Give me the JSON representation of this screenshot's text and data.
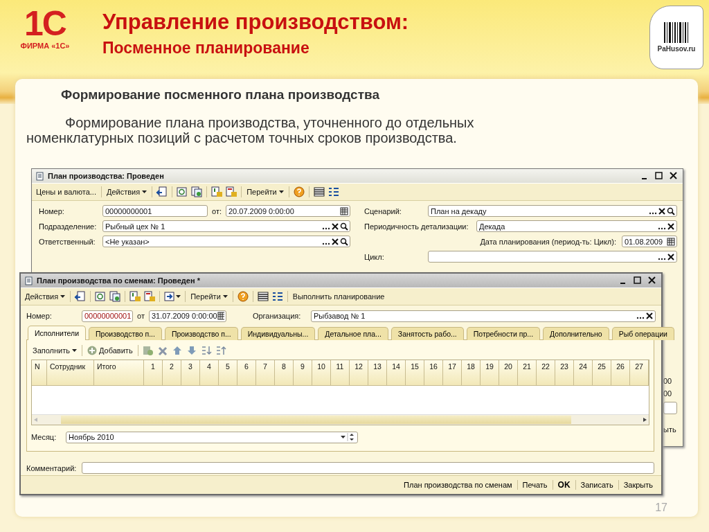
{
  "slide": {
    "logo_mark": "1С",
    "logo_caption": "ФИРМА «1С»",
    "title": "Управление производством:",
    "subtitle": "Посменное планирование",
    "site_logo": "PaHusov.ru",
    "heading": "Формирование посменного плана производства",
    "body": "Формирование плана производства, уточненного до отдельных номенклатурных позиций с расчетом точных сроков производства.",
    "page_number": "17"
  },
  "back_window": {
    "title": "План производства: Проведен",
    "toolbar": [
      {
        "kind": "plain",
        "label": "Цены и валюта..."
      },
      {
        "kind": "menu",
        "label": "Действия"
      },
      {
        "kind": "menu",
        "label": "Перейти"
      }
    ],
    "left_fields": [
      {
        "label": "Номер:",
        "kind": "plain",
        "value": "00000000001",
        "date_label": "от:",
        "date": "20.07.2009  0:00:00"
      },
      {
        "label": "Подразделение:",
        "kind": "reference",
        "value": "Рыбный цех № 1"
      },
      {
        "label": "Ответственный:",
        "kind": "reference",
        "value": "<Не указан>"
      }
    ],
    "right_fields": [
      {
        "label": "Сценарий:",
        "kind": "reference",
        "value": "План на декаду"
      },
      {
        "label": "Периодичность детализации:",
        "kind": "choice",
        "value": "Декада"
      },
      {
        "label": "Дата планирования (период-ть: Цикл):",
        "kind": "date",
        "value": "01.08.2009"
      },
      {
        "label": "Цикл:",
        "kind": "choice"
      }
    ],
    "hidden_fragments": [
      "00",
      "00",
      "ыть"
    ]
  },
  "front_window": {
    "title": "План производства по сменам: Проведен *",
    "toolbar": [
      {
        "kind": "menu",
        "label": "Действия"
      },
      {
        "kind": "menu",
        "label": "Перейти"
      },
      {
        "kind": "plain",
        "label": "Выполнить планирование"
      }
    ],
    "number_label": "Номер:",
    "number": "00000000001",
    "date_label": "от",
    "date": "31.07.2009  0:00:00",
    "org_label": "Организация:",
    "org": "Рыбзавод № 1",
    "tabs": [
      {
        "label": "Исполнители",
        "selected": true
      },
      {
        "label": "Производство п...",
        "selected": false
      },
      {
        "label": "Производство п...",
        "selected": false
      },
      {
        "label": "Индивидуальны...",
        "selected": false
      },
      {
        "label": "Детальное пла...",
        "selected": false
      },
      {
        "label": "Занятость рабо...",
        "selected": false
      },
      {
        "label": "Потребности пр...",
        "selected": false
      },
      {
        "label": "Дополнительно",
        "selected": false
      },
      {
        "label": "Рыб операции",
        "selected": false
      }
    ],
    "panel_toolbar": [
      {
        "kind": "menu",
        "label": "Заполнить"
      },
      {
        "kind": "plain",
        "label": "Добавить"
      }
    ],
    "table": {
      "columns": [
        "N",
        "Сотрудник",
        "Итого",
        "1",
        "2",
        "3",
        "4",
        "5",
        "6",
        "7",
        "8",
        "9",
        "10",
        "11",
        "12",
        "13",
        "14",
        "15",
        "16",
        "17",
        "18",
        "19",
        "20",
        "21",
        "22",
        "23",
        "24",
        "25",
        "26",
        "27"
      ]
    },
    "month_label": "Месяц:",
    "month": "Ноябрь 2010",
    "comment_label": "Комментарий:",
    "footer_buttons": [
      {
        "label": "План производства по сменам",
        "default": false
      },
      {
        "label": "Печать",
        "default": false
      },
      {
        "label": "OK",
        "default": true
      },
      {
        "label": "Записать",
        "default": false
      },
      {
        "label": "Закрыть",
        "default": false
      }
    ]
  }
}
